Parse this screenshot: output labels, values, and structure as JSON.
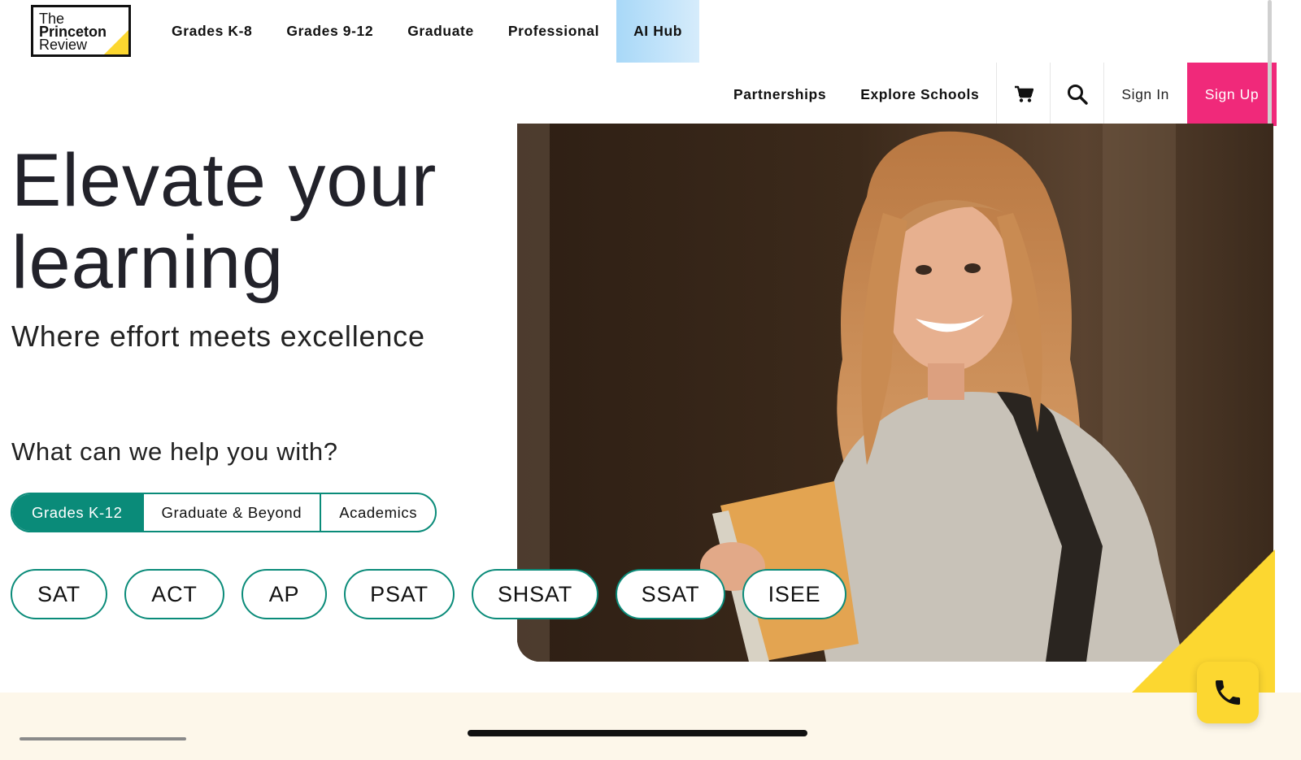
{
  "logo": {
    "line1": "The",
    "line2": "Princeton",
    "line3": "Review",
    "accent_color": "#fcd730"
  },
  "top_nav": {
    "items": [
      "Grades K-8",
      "Grades 9-12",
      "Graduate",
      "Professional",
      "AI Hub"
    ]
  },
  "sub_nav": {
    "partnerships": "Partnerships",
    "explore_schools": "Explore Schools",
    "cart_icon": "cart-icon",
    "search_icon": "search-icon",
    "sign_in": "Sign In",
    "sign_up": "Sign Up",
    "sign_up_color": "#f0297a"
  },
  "hero": {
    "title_line1": "Elevate your",
    "title_line2": "learning",
    "subtitle": "Where effort meets excellence",
    "help_prompt": "What can we help you with?"
  },
  "tabs": {
    "items": [
      "Grades K-12",
      "Graduate & Beyond",
      "Academics"
    ],
    "active": "Grades K-12",
    "accent_color": "#0a8b79"
  },
  "tests": [
    "SAT",
    "ACT",
    "AP",
    "PSAT",
    "SHSAT",
    "SSAT",
    "ISEE"
  ],
  "contact": {
    "phone_icon": "phone-icon",
    "color": "#fcd730"
  }
}
